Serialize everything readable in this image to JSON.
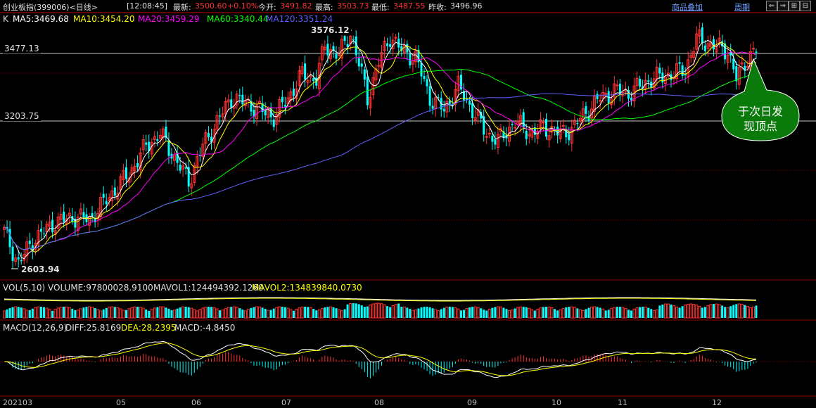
{
  "header": {
    "symbol": "创业板指(399006)<日线>",
    "time": "[12:08:45]",
    "latest_label": "最新:",
    "latest_value": "3500.60",
    "change_pct": "+0.10%",
    "open_label": "今开:",
    "open_value": "3491.82",
    "high_label": "最高:",
    "high_value": "3503.73",
    "low_label": "最低:",
    "low_value": "3487.55",
    "prev_label": "昨收:",
    "prev_value": "3496.96",
    "overlay_button": "商品叠加",
    "period_button": "周期",
    "nav_left": "⇐",
    "nav_right": "⇒",
    "nav_expand": "⊞",
    "nav_collapse": "⊟"
  },
  "price_panel": {
    "k_label": "K",
    "ma5": "MA5:3469.68",
    "ma10": "MA10:3454.20",
    "ma20": "MA20:3459.29",
    "ma60": "MA60:3340.44",
    "ma120": "MA120:3351.24",
    "level_high": "3477.13",
    "level_mid": "3203.75",
    "peak_label": "3576.12",
    "low_label": "2603.94",
    "callout": [
      "于次日发",
      "现顶点"
    ]
  },
  "volume_panel": {
    "vol_label": "VOL(5,10)",
    "volume": "VOLUME:97800028.9100",
    "mavol1": "MAVOL1:124494392.1260",
    "mavol2": "MAVOL2:134839840.0730"
  },
  "macd_panel": {
    "macd_label": "MACD(12,26,9)",
    "diff": "DIFF:25.8169",
    "dea": "DEA:28.2395",
    "macd": "MACD:-4.8450"
  },
  "x_axis": [
    "202103",
    "05",
    "06",
    "07",
    "08",
    "09",
    "10",
    "11",
    "12"
  ],
  "colors": {
    "up": "#ff3232",
    "down": "#00ffff",
    "ma5": "#ffffff",
    "ma10": "#ffff00",
    "ma20": "#ff00ff",
    "ma60": "#00ff00",
    "ma120": "#6060ff",
    "callout_fill": "#0a7a0a"
  },
  "chart_data": {
    "type": "candlestick",
    "series_anchor_close": [
      [
        0,
        2740
      ],
      [
        5,
        2603.94
      ],
      [
        10,
        2700
      ],
      [
        18,
        2780
      ],
      [
        25,
        2800
      ],
      [
        30,
        2790
      ],
      [
        38,
        2900
      ],
      [
        45,
        3000
      ],
      [
        50,
        3100
      ],
      [
        55,
        3150
      ],
      [
        60,
        3050
      ],
      [
        65,
        2950
      ],
      [
        70,
        3100
      ],
      [
        75,
        3200
      ],
      [
        80,
        3300
      ],
      [
        85,
        3280
      ],
      [
        90,
        3250
      ],
      [
        95,
        3220
      ],
      [
        100,
        3300
      ],
      [
        105,
        3400
      ],
      [
        110,
        3380
      ],
      [
        113,
        3520
      ],
      [
        118,
        3480
      ],
      [
        122,
        3576.12
      ],
      [
        126,
        3400
      ],
      [
        128,
        3300
      ],
      [
        132,
        3450
      ],
      [
        136,
        3560
      ],
      [
        140,
        3500
      ],
      [
        145,
        3470
      ],
      [
        150,
        3300
      ],
      [
        155,
        3250
      ],
      [
        160,
        3350
      ],
      [
        165,
        3250
      ],
      [
        170,
        3150
      ],
      [
        174,
        3120
      ],
      [
        180,
        3200
      ],
      [
        186,
        3150
      ],
      [
        190,
        3180
      ],
      [
        196,
        3150
      ],
      [
        200,
        3170
      ],
      [
        205,
        3240
      ],
      [
        210,
        3300
      ],
      [
        215,
        3330
      ],
      [
        220,
        3320
      ],
      [
        228,
        3380
      ],
      [
        235,
        3400
      ],
      [
        240,
        3420
      ],
      [
        244,
        3550
      ],
      [
        250,
        3520
      ],
      [
        255,
        3500
      ],
      [
        258,
        3380
      ],
      [
        262,
        3470
      ],
      [
        265,
        3500
      ]
    ]
  }
}
